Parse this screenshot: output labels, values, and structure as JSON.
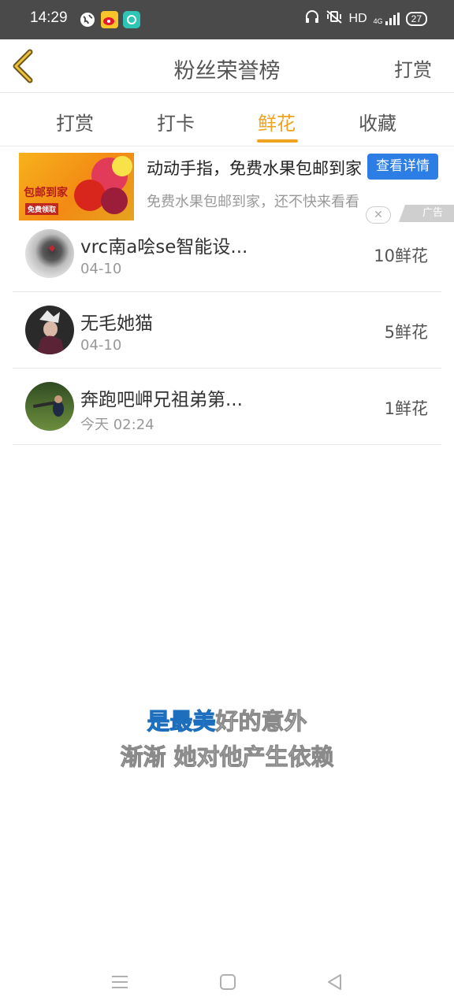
{
  "status_bar": {
    "time": "14:29",
    "network": "HD",
    "signal": "4G",
    "battery": "27",
    "icons": [
      "browser-icon",
      "weibo-icon",
      "chat-app-icon",
      "headphones-icon",
      "vibrate-off-icon",
      "hd-icon",
      "signal-icon",
      "battery-icon"
    ]
  },
  "header": {
    "back_icon": "chevron-left-icon",
    "title": "粉丝荣誉榜",
    "action": "打赏"
  },
  "tabs": [
    {
      "label": "打赏",
      "active": false
    },
    {
      "label": "打卡",
      "active": false
    },
    {
      "label": "鲜花",
      "active": true
    },
    {
      "label": "收藏",
      "active": false
    }
  ],
  "ad": {
    "title": "动动手指，免费水果包邮到家",
    "subtitle": "免费水果包邮到家，还不快来看看",
    "button": "查看详情",
    "close": "✕",
    "label": "广告",
    "image_text_1": "包邮到家",
    "image_text_2": "免费领取"
  },
  "list": [
    {
      "name": "vrc南a哙se智能设...",
      "date": "04-10",
      "count": "10鲜花"
    },
    {
      "name": "无毛她猫",
      "date": "04-10",
      "count": "5鲜花"
    },
    {
      "name": "奔跑吧岬兄祖弟第...",
      "date": "今天 02:24",
      "count": "1鲜花"
    }
  ],
  "overlay": {
    "line1_highlight": "是最美",
    "line1_rest": "好的意外",
    "line2": "渐渐 她对他产生依赖"
  },
  "nav": {
    "icons": [
      "menu-icon",
      "home-icon",
      "back-icon"
    ]
  },
  "colors": {
    "accent": "#f0a31e",
    "ad_button": "#2c7de4",
    "status_bar": "#4a4a4a"
  }
}
